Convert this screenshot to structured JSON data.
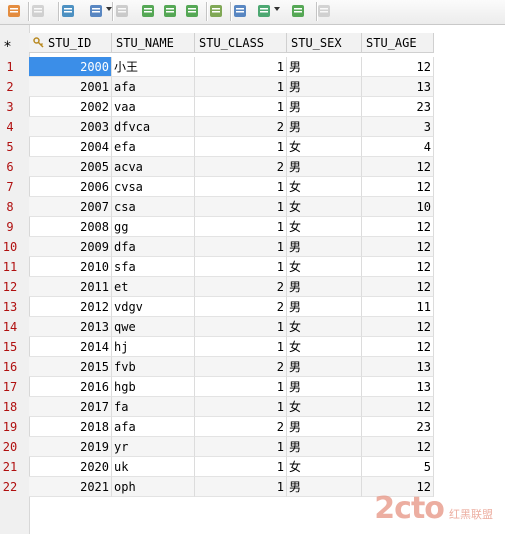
{
  "toolbar": {
    "buttons": [
      {
        "icon": "refresh-icon",
        "color": "#e07a20"
      },
      {
        "icon": "stop-icon",
        "color": "#999999",
        "dim": true
      },
      {
        "icon": "export-icon",
        "color": "#2f7fb8"
      },
      {
        "icon": "filter-icon",
        "color": "#3d73b8",
        "dropdown": true
      },
      {
        "icon": "copy-icon",
        "color": "#8a8a8a",
        "dim": true
      },
      {
        "icon": "grid-add-row-icon",
        "color": "#3a9a3a"
      },
      {
        "icon": "grid-delete-row-icon",
        "color": "#3a9a3a"
      },
      {
        "icon": "grid-edit-icon",
        "color": "#3a9a3a"
      },
      {
        "icon": "sql-edit-icon",
        "color": "#6b9a3a"
      },
      {
        "icon": "commit-icon",
        "color": "#3d73b8"
      },
      {
        "icon": "rollback-icon",
        "color": "#2f9a5a",
        "dropdown": true
      },
      {
        "icon": "refresh-data-icon",
        "color": "#3a9a3a"
      },
      {
        "icon": "undo-icon",
        "color": "#9a9a9a",
        "dim": true
      }
    ]
  },
  "gutter": {
    "new_row_marker": "*"
  },
  "columns": [
    {
      "label": "STU_ID",
      "key_icon": true
    },
    {
      "label": "STU_NAME"
    },
    {
      "label": "STU_CLASS"
    },
    {
      "label": "STU_SEX"
    },
    {
      "label": "STU_AGE"
    }
  ],
  "rows": [
    {
      "n": "1",
      "id": "2000",
      "name": "小王",
      "cls": "1",
      "sex": "男",
      "age": "12"
    },
    {
      "n": "2",
      "id": "2001",
      "name": "afa",
      "cls": "1",
      "sex": "男",
      "age": "13"
    },
    {
      "n": "3",
      "id": "2002",
      "name": "vaa",
      "cls": "1",
      "sex": "男",
      "age": "23"
    },
    {
      "n": "4",
      "id": "2003",
      "name": "dfvca",
      "cls": "2",
      "sex": "男",
      "age": "3"
    },
    {
      "n": "5",
      "id": "2004",
      "name": "efa",
      "cls": "1",
      "sex": "女",
      "age": "4"
    },
    {
      "n": "6",
      "id": "2005",
      "name": "acva",
      "cls": "2",
      "sex": "男",
      "age": "12"
    },
    {
      "n": "7",
      "id": "2006",
      "name": "cvsa",
      "cls": "1",
      "sex": "女",
      "age": "12"
    },
    {
      "n": "8",
      "id": "2007",
      "name": "csa",
      "cls": "1",
      "sex": "女",
      "age": "10"
    },
    {
      "n": "9",
      "id": "2008",
      "name": "gg",
      "cls": "1",
      "sex": "女",
      "age": "12"
    },
    {
      "n": "10",
      "id": "2009",
      "name": "dfa",
      "cls": "1",
      "sex": "男",
      "age": "12"
    },
    {
      "n": "11",
      "id": "2010",
      "name": "sfa",
      "cls": "1",
      "sex": "女",
      "age": "12"
    },
    {
      "n": "12",
      "id": "2011",
      "name": "et",
      "cls": "2",
      "sex": "男",
      "age": "12"
    },
    {
      "n": "13",
      "id": "2012",
      "name": "vdgv",
      "cls": "2",
      "sex": "男",
      "age": "11"
    },
    {
      "n": "14",
      "id": "2013",
      "name": "qwe",
      "cls": "1",
      "sex": "女",
      "age": "12"
    },
    {
      "n": "15",
      "id": "2014",
      "name": "hj",
      "cls": "1",
      "sex": "女",
      "age": "12"
    },
    {
      "n": "16",
      "id": "2015",
      "name": "fvb",
      "cls": "2",
      "sex": "男",
      "age": "13"
    },
    {
      "n": "17",
      "id": "2016",
      "name": "hgb",
      "cls": "1",
      "sex": "男",
      "age": "13"
    },
    {
      "n": "18",
      "id": "2017",
      "name": "fa",
      "cls": "1",
      "sex": "女",
      "age": "12"
    },
    {
      "n": "19",
      "id": "2018",
      "name": "afa",
      "cls": "2",
      "sex": "男",
      "age": "23"
    },
    {
      "n": "20",
      "id": "2019",
      "name": "yr",
      "cls": "1",
      "sex": "男",
      "age": "12"
    },
    {
      "n": "21",
      "id": "2020",
      "name": "uk",
      "cls": "1",
      "sex": "女",
      "age": "5"
    },
    {
      "n": "22",
      "id": "2021",
      "name": "oph",
      "cls": "1",
      "sex": "男",
      "age": "12"
    }
  ],
  "selection": {
    "row": 0,
    "column": "id",
    "color": "#3b8ee8"
  },
  "watermark": {
    "logo_text": "2cto",
    "logo_sub": "红黑联盟",
    "color": "#e89a8a"
  }
}
